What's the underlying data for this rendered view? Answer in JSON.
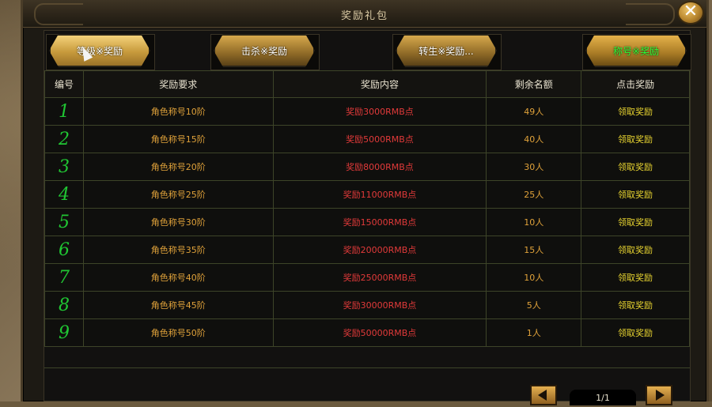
{
  "window": {
    "title": "奖励礼包"
  },
  "tabs": [
    {
      "label": "等级※奖励"
    },
    {
      "label": "击杀※奖励"
    },
    {
      "label": "转生※奖励..."
    },
    {
      "label": "称号※奖励"
    }
  ],
  "table": {
    "headers": [
      "编号",
      "奖励要求",
      "奖励内容",
      "剩余名额",
      "点击奖励"
    ],
    "rows": [
      {
        "num": "1",
        "req": "角色称号10阶",
        "reward": "奖励3000RMB点",
        "remain": "49人",
        "claim": "领取奖励"
      },
      {
        "num": "2",
        "req": "角色称号15阶",
        "reward": "奖励5000RMB点",
        "remain": "40人",
        "claim": "领取奖励"
      },
      {
        "num": "3",
        "req": "角色称号20阶",
        "reward": "奖励8000RMB点",
        "remain": "30人",
        "claim": "领取奖励"
      },
      {
        "num": "4",
        "req": "角色称号25阶",
        "reward": "奖励11000RMB点",
        "remain": "25人",
        "claim": "领取奖励"
      },
      {
        "num": "5",
        "req": "角色称号30阶",
        "reward": "奖励15000RMB点",
        "remain": "10人",
        "claim": "领取奖励"
      },
      {
        "num": "6",
        "req": "角色称号35阶",
        "reward": "奖励20000RMB点",
        "remain": "15人",
        "claim": "领取奖励"
      },
      {
        "num": "7",
        "req": "角色称号40阶",
        "reward": "奖励25000RMB点",
        "remain": "10人",
        "claim": "领取奖励"
      },
      {
        "num": "8",
        "req": "角色称号45阶",
        "reward": "奖励30000RMB点",
        "remain": "5人",
        "claim": "领取奖励"
      },
      {
        "num": "9",
        "req": "角色称号50阶",
        "reward": "奖励50000RMB点",
        "remain": "1人",
        "claim": "领取奖励"
      }
    ]
  },
  "pager": {
    "page": "1/1"
  },
  "icons": {
    "close": "close-icon",
    "prev": "arrow-left-icon",
    "next": "arrow-right-icon"
  },
  "colors": {
    "number": "#20c633",
    "requirement": "#e0a23a",
    "reward": "#e23a3a",
    "claim": "#e8d430",
    "active_tab": "#29ff39"
  }
}
